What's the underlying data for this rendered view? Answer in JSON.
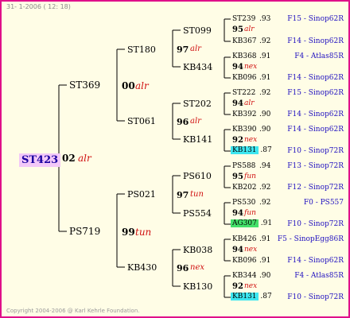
{
  "header": "31- 1-2006 ( 12: 18)",
  "footer": "Copyright 2004-2006 @ Karl Kehrle Foundation.",
  "root": {
    "name": "ST423",
    "num": "02",
    "yr": "alr"
  },
  "gen1": [
    {
      "name": "ST369",
      "num": "00",
      "yr": "alr"
    },
    {
      "name": "PS719",
      "num": "99",
      "yr": "tun"
    }
  ],
  "gen2": [
    {
      "name": "ST180",
      "num": "97",
      "yr": "alr"
    },
    {
      "name": "ST061",
      "num": "96",
      "yr": "alr"
    },
    {
      "name": "PS021",
      "num": "97",
      "yr": "tun"
    },
    {
      "name": "KB430",
      "num": "96",
      "yr": "nex"
    }
  ],
  "gen3": [
    {
      "name": "ST099",
      "num": "95",
      "yr": "alr"
    },
    {
      "name": "KB434",
      "num": "94",
      "yr": "nex"
    },
    {
      "name": "ST202",
      "num": "94",
      "yr": "alr"
    },
    {
      "name": "KB141",
      "num": "92",
      "yr": "nex"
    },
    {
      "name": "PS610",
      "num": "95",
      "yr": "fun"
    },
    {
      "name": "PS554",
      "num": "94",
      "yr": "fun"
    },
    {
      "name": "KB038",
      "num": "94",
      "yr": "nex"
    },
    {
      "name": "KB130",
      "num": "92",
      "yr": "nex"
    }
  ],
  "gen4": [
    {
      "name": "ST239",
      "val": ".93",
      "right": "F15 - Sinop62R"
    },
    {
      "name": "KB367",
      "val": ".92",
      "right": "F14 - Sinop62R"
    },
    {
      "name": "KB368",
      "val": ".91",
      "right": "F4 - Atlas85R"
    },
    {
      "name": "KB096",
      "val": ".91",
      "right": "F14 - Sinop62R"
    },
    {
      "name": "ST222",
      "val": ".92",
      "right": "F15 - Sinop62R"
    },
    {
      "name": "KB392",
      "val": ".90",
      "right": "F14 - Sinop62R"
    },
    {
      "name": "KB390",
      "val": ".90",
      "right": "F14 - Sinop62R"
    },
    {
      "name": "KB131",
      "val": ".87",
      "right": "F10 - Sinop72R"
    },
    {
      "name": "PS588",
      "val": ".94",
      "right": "F13 - Sinop72R"
    },
    {
      "name": "KB202",
      "val": ".92",
      "right": "F12 - Sinop72R"
    },
    {
      "name": "PS530",
      "val": ".92",
      "right": "F0 - PS557"
    },
    {
      "name": "AG307",
      "val": ".91",
      "right": "F10 - Sinop72R"
    },
    {
      "name": "KB426",
      "val": ".91",
      "right": "F5 - SinopEgg86R"
    },
    {
      "name": "KB096",
      "val": ".91",
      "right": "F14 - Sinop62R"
    },
    {
      "name": "KB344",
      "val": ".90",
      "right": "F4 - Atlas85R"
    },
    {
      "name": "KB131",
      "val": ".87",
      "right": "F10 - Sinop72R"
    }
  ]
}
